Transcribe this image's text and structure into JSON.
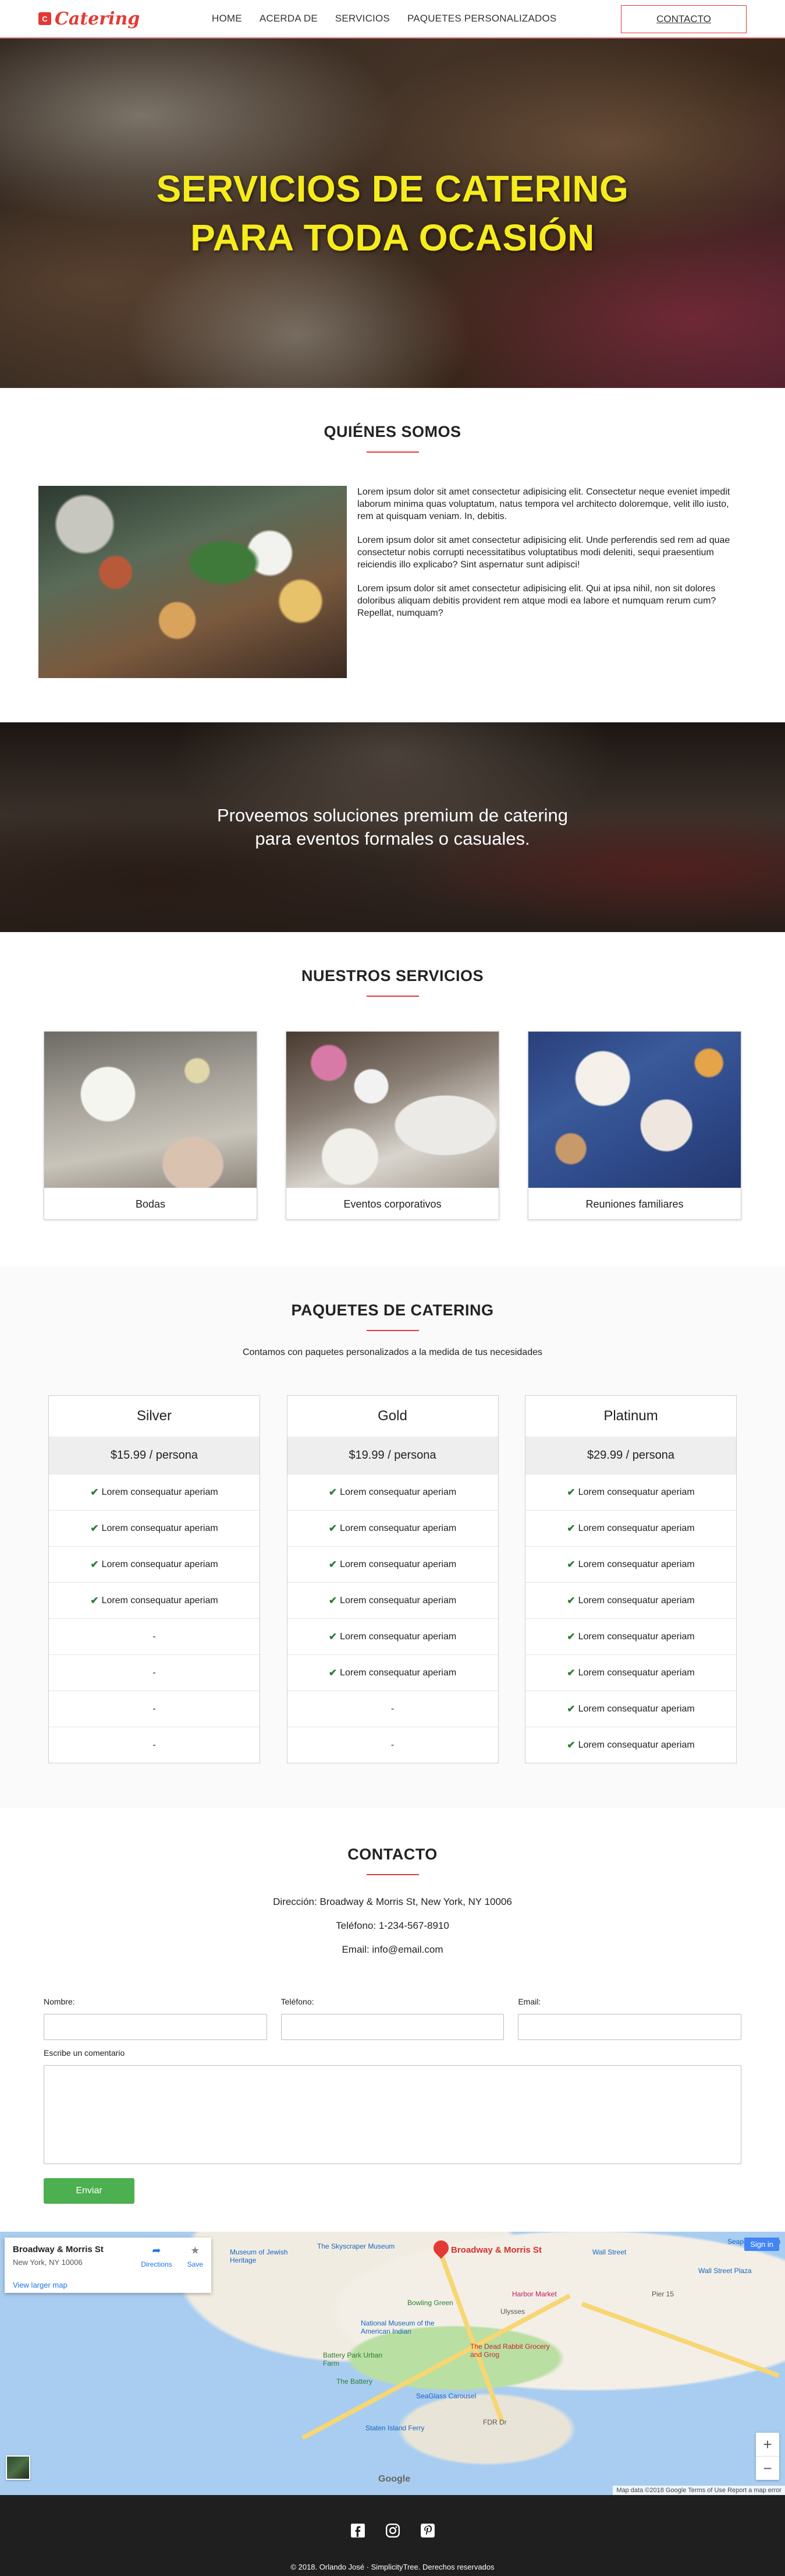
{
  "brand": {
    "name": "Catering",
    "logo_glyph": "C"
  },
  "nav": {
    "items": [
      "HOME",
      "ACERDA DE",
      "SERVICIOS",
      "PAQUETES PERSONALIZADOS"
    ],
    "contact_button": "CONTACTO"
  },
  "hero": {
    "line1": "SERVICIOS DE CATERING",
    "line2": "PARA TODA OCASIÓN"
  },
  "quienes": {
    "title": "QUIÉNES SOMOS",
    "paragraphs": [
      "Lorem ipsum dolor sit amet consectetur adipisicing elit. Consectetur neque eveniet impedit laborum minima quas voluptatum, natus tempora vel architecto doloremque, velit illo iusto, rem at quisquam veniam. In, debitis.",
      "Lorem ipsum dolor sit amet consectetur adipisicing elit. Unde perferendis sed rem ad quae consectetur nobis corrupti necessitatibus voluptatibus modi deleniti, sequi praesentium reiciendis illo explicabo? Sint aspernatur sunt adipisci!",
      "Lorem ipsum dolor sit amet consectetur adipisicing elit. Qui at ipsa nihil, non sit dolores doloribus aliquam debitis provident rem atque modi ea labore et numquam rerum cum? Repellat, numquam?"
    ]
  },
  "banner": {
    "line1": "Proveemos soluciones premium de catering",
    "line2": "para eventos formales o casuales."
  },
  "servicios": {
    "title": "NUESTROS SERVICIOS",
    "cards": [
      "Bodas",
      "Eventos corporativos",
      "Reuniones familiares"
    ]
  },
  "paquetes": {
    "title": "PAQUETES DE CATERING",
    "subtitle": "Contamos con paquetes personalizados a la medida de tus necesidades",
    "plans": [
      {
        "name": "Silver",
        "price": "$15.99 / persona",
        "items": [
          "Lorem consequatur aperiam",
          "Lorem consequatur aperiam",
          "Lorem consequatur aperiam",
          "Lorem consequatur aperiam",
          "-",
          "-",
          "-",
          "-"
        ]
      },
      {
        "name": "Gold",
        "price": "$19.99 / persona",
        "items": [
          "Lorem consequatur aperiam",
          "Lorem consequatur aperiam",
          "Lorem consequatur aperiam",
          "Lorem consequatur aperiam",
          "Lorem consequatur aperiam",
          "Lorem consequatur aperiam",
          "-",
          "-"
        ]
      },
      {
        "name": "Platinum",
        "price": "$29.99 / persona",
        "items": [
          "Lorem consequatur aperiam",
          "Lorem consequatur aperiam",
          "Lorem consequatur aperiam",
          "Lorem consequatur aperiam",
          "Lorem consequatur aperiam",
          "Lorem consequatur aperiam",
          "Lorem consequatur aperiam",
          "Lorem consequatur aperiam"
        ]
      }
    ]
  },
  "contacto": {
    "title": "CONTACTO",
    "address": "Dirección: Broadway & Morris St, New York, NY 10006",
    "phone": "Teléfono: 1-234-567-8910",
    "email": "Email: info@email.com",
    "form": {
      "name_label": "Nombre:",
      "phone_label": "Teléfono:",
      "email_label": "Email:",
      "comment_label": "Escribe un comentario",
      "submit": "Enviar"
    }
  },
  "map": {
    "place_title": "Broadway & Morris St",
    "place_address": "New York, NY 10006",
    "directions": "Directions",
    "save": "Save",
    "view_larger": "View larger map",
    "pin_label": "Broadway & Morris St",
    "sign_in": "Sign in",
    "attribution": "Map data ©2018 Google   Terms of Use   Report a map error",
    "google": "Google",
    "pois": [
      {
        "label": "The Skyscraper Museum",
        "kind": "blue"
      },
      {
        "label": "Wall Street",
        "kind": "blue"
      },
      {
        "label": "Seaport Museum",
        "kind": "blue"
      },
      {
        "label": "Bowling Green",
        "kind": "green"
      },
      {
        "label": "National Museum of the American Indian",
        "kind": "blue"
      },
      {
        "label": "Battery Park Urban Farm",
        "kind": "green"
      },
      {
        "label": "The Battery",
        "kind": "green"
      },
      {
        "label": "SeaGlass Carousel",
        "kind": "blue"
      },
      {
        "label": "Staten Island Ferry",
        "kind": "blue"
      },
      {
        "label": "The Dead Rabbit Grocery and Grog",
        "kind": "plain"
      },
      {
        "label": "Pier 15",
        "kind": "plain"
      },
      {
        "label": "Wall Street Plaza",
        "kind": "blue"
      },
      {
        "label": "Ulysses",
        "kind": "plain"
      },
      {
        "label": "Harbor Market",
        "kind": "plain"
      },
      {
        "label": "FDR Dr",
        "kind": "plain"
      },
      {
        "label": "Museum of Jewish Heritage",
        "kind": "blue"
      }
    ]
  },
  "footer": {
    "social": [
      "facebook-icon",
      "instagram-icon",
      "pinterest-icon"
    ],
    "copyright": "© 2018. Orlando José · SimplicityTree. Derechos reservados"
  },
  "colors": {
    "accent": "#e53935",
    "hero_text": "#f7ec1b",
    "send_button": "#4caf50",
    "check": "#2e7d32",
    "footer_bg": "#1f1f1f"
  }
}
